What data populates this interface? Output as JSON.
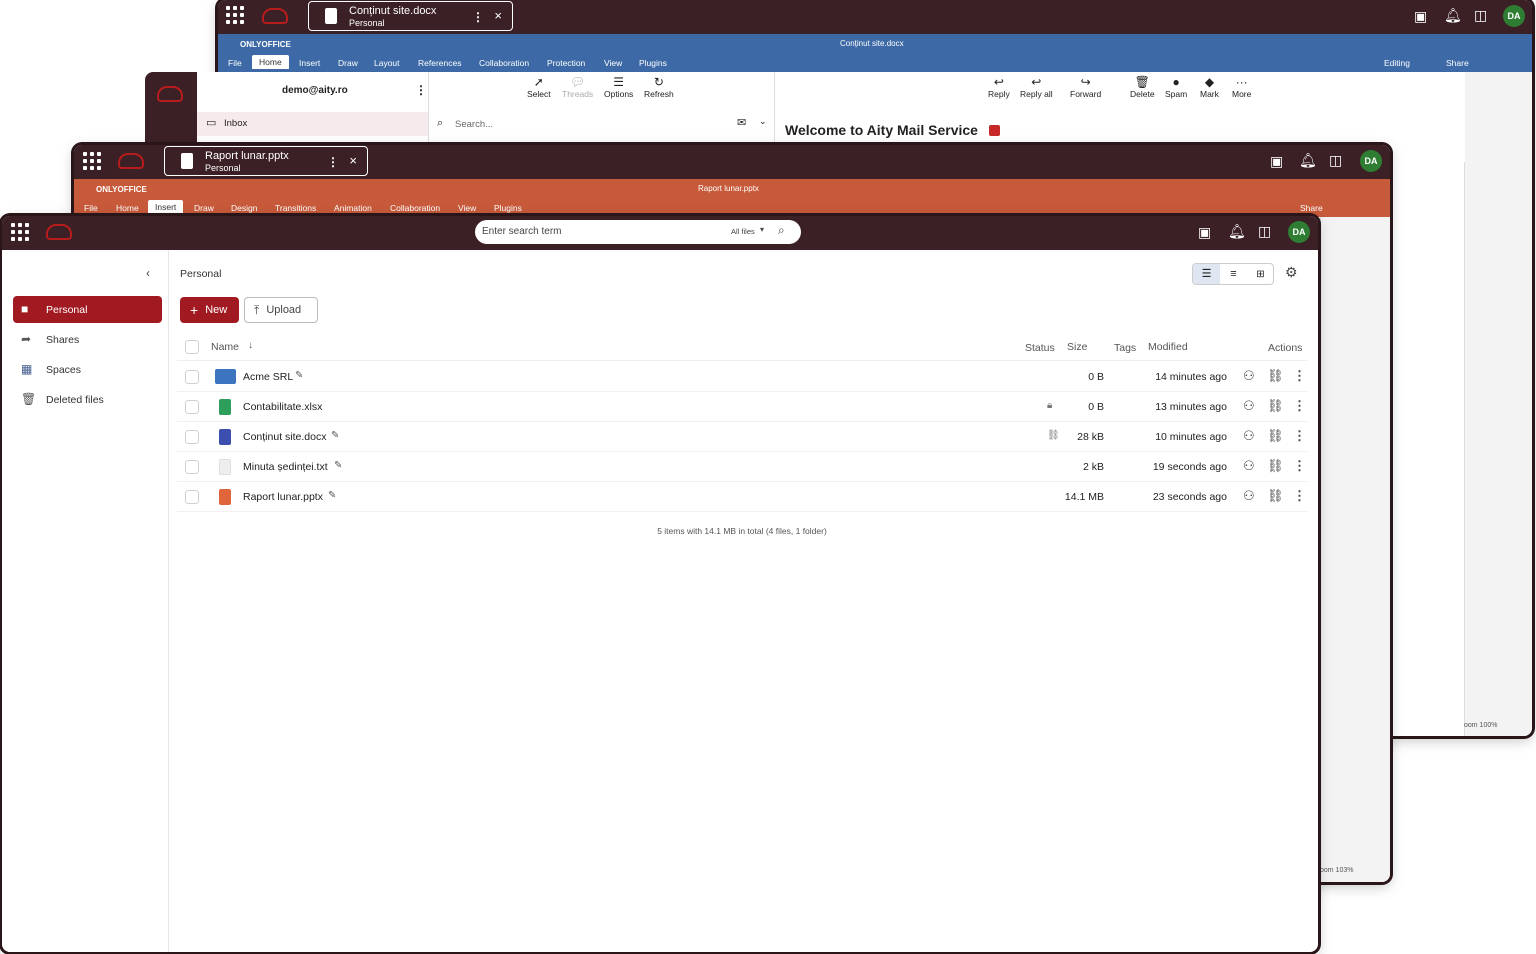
{
  "word_window": {
    "tab_title": "Conținut site.docx",
    "tab_location": "Personal",
    "oo_brand": "ONLYOFFICE",
    "doc_title": "Conținut site.docx",
    "menu": [
      "File",
      "Home",
      "Insert",
      "Draw",
      "Layout",
      "References",
      "Collaboration",
      "Protection",
      "View",
      "Plugins"
    ],
    "active_menu": "Home",
    "mode": "Editing",
    "share": "Share",
    "zoom": "oom 100%",
    "avatar": "DA"
  },
  "mail_window": {
    "account": "demo@aity.ro",
    "folder": "Inbox",
    "search_placeholder": "Search...",
    "toolbar_left": [
      "Select",
      "Threads",
      "Options",
      "Refresh"
    ],
    "toolbar_right": [
      "Reply",
      "Reply all",
      "Forward",
      "Delete",
      "Spam",
      "Mark",
      "More"
    ],
    "heading": "Welcome to Aity Mail Service"
  },
  "slides_window": {
    "tab_title": "Raport lunar.pptx",
    "tab_location": "Personal",
    "oo_brand": "ONLYOFFICE",
    "doc_title": "Raport lunar.pptx",
    "menu": [
      "File",
      "Home",
      "Insert",
      "Draw",
      "Design",
      "Transitions",
      "Animation",
      "Collaboration",
      "View",
      "Plugins"
    ],
    "active_menu": "Insert",
    "share": "Share",
    "zoom": "oom 103%",
    "avatar": "DA"
  },
  "files_window": {
    "search_placeholder": "Enter search term",
    "search_scope": "All files",
    "avatar": "DA",
    "breadcrumb": "Personal",
    "nav": [
      "Personal",
      "Shares",
      "Spaces",
      "Deleted files"
    ],
    "new_label": "New",
    "upload_label": "Upload",
    "columns": {
      "name": "Name",
      "status": "Status",
      "size": "Size",
      "tags": "Tags",
      "modified": "Modified",
      "actions": "Actions"
    },
    "files": [
      {
        "name": "Acme SRL",
        "size": "0 B",
        "modified": "14 minutes ago",
        "type": "folder"
      },
      {
        "name": "Contabilitate.xlsx",
        "size": "0 B",
        "modified": "13 minutes ago",
        "type": "sheet"
      },
      {
        "name": "Conținut site.docx",
        "size": "28 kB",
        "modified": "10 minutes ago",
        "type": "doc"
      },
      {
        "name": "Minuta ședinței.txt",
        "size": "2 kB",
        "modified": "19 seconds ago",
        "type": "txt"
      },
      {
        "name": "Raport lunar.pptx",
        "size": "14.1 MB",
        "modified": "23 seconds ago",
        "type": "slides"
      }
    ],
    "summary": "5 items with 14.1 MB in total (4 files, 1 folder)",
    "colors": {
      "accent": "#a11a22",
      "topbar": "#3b2125",
      "word_blue": "#3d6aa6",
      "slides_orange": "#c65a3a"
    }
  }
}
